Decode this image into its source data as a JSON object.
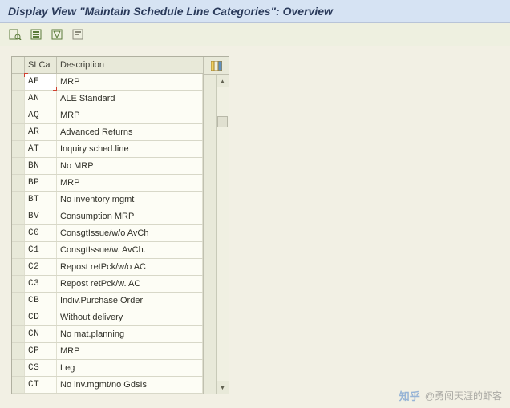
{
  "title": "Display View \"Maintain Schedule Line Categories\": Overview",
  "columns": {
    "select": "",
    "slca": "SLCa",
    "desc": "Description"
  },
  "rows": [
    {
      "code": "AE",
      "desc": "MRP"
    },
    {
      "code": "AN",
      "desc": "ALE Standard"
    },
    {
      "code": "AQ",
      "desc": "MRP"
    },
    {
      "code": "AR",
      "desc": "Advanced Returns"
    },
    {
      "code": "AT",
      "desc": "Inquiry sched.line"
    },
    {
      "code": "BN",
      "desc": "No MRP"
    },
    {
      "code": "BP",
      "desc": "MRP"
    },
    {
      "code": "BT",
      "desc": "No inventory mgmt"
    },
    {
      "code": "BV",
      "desc": "Consumption MRP"
    },
    {
      "code": "C0",
      "desc": "ConsgtIssue/w/o AvCh"
    },
    {
      "code": "C1",
      "desc": "ConsgtIssue/w. AvCh."
    },
    {
      "code": "C2",
      "desc": "Repost retPck/w/o AC"
    },
    {
      "code": "C3",
      "desc": "Repost retPck/w. AC"
    },
    {
      "code": "CB",
      "desc": "Indiv.Purchase Order"
    },
    {
      "code": "CD",
      "desc": "Without delivery"
    },
    {
      "code": "CN",
      "desc": "No mat.planning"
    },
    {
      "code": "CP",
      "desc": "MRP"
    },
    {
      "code": "CS",
      "desc": "Leg"
    },
    {
      "code": "CT",
      "desc": "No inv.mgmt/no GdsIs"
    }
  ],
  "watermark": {
    "logo": "知乎",
    "user": "@勇闯天涯的虾客"
  }
}
